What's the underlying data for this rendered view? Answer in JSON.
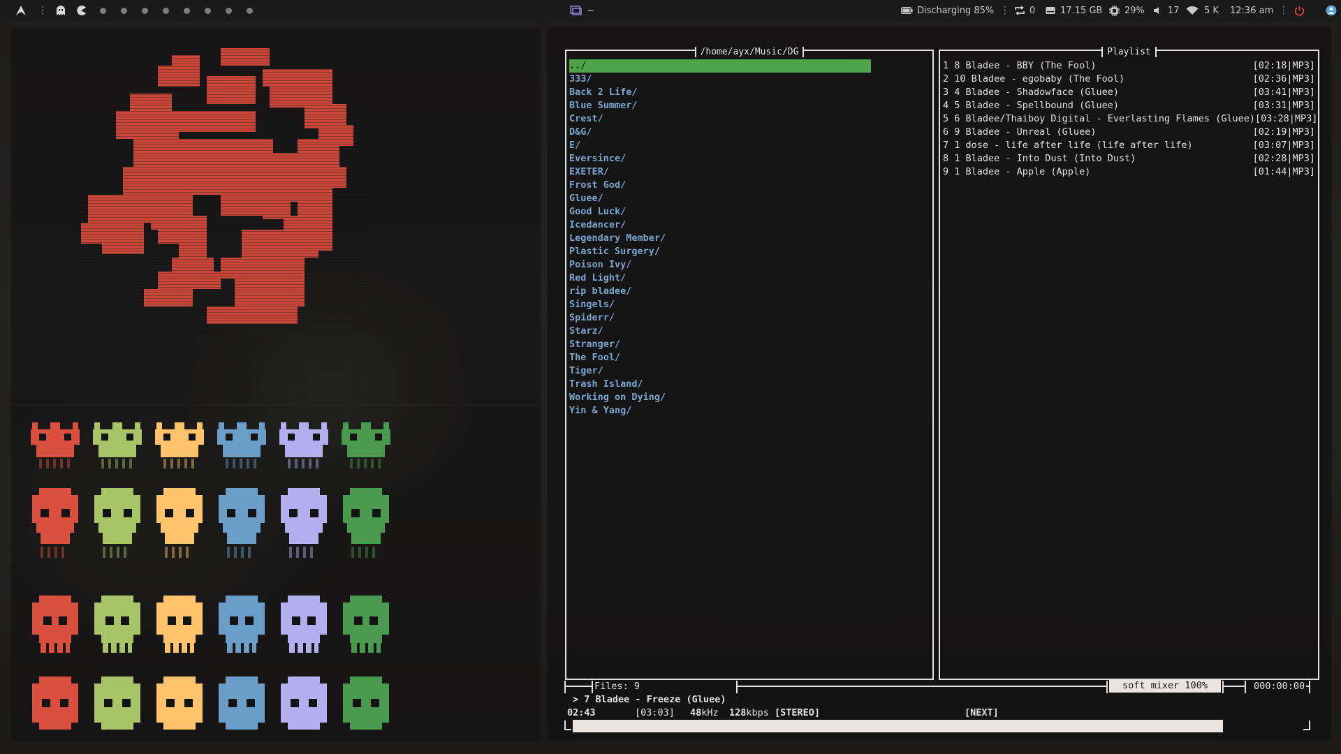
{
  "topbar": {
    "workspace_count": 8,
    "window_title": "~",
    "battery": "Discharging 85%",
    "updates": "0",
    "disk": "17.15 GB",
    "cpu": "29%",
    "volume": "17",
    "network": "5 K",
    "clock": "12:36 am",
    "icons": [
      "arch-logo-icon",
      "ghost-icon",
      "pacman-icon",
      "window-icon",
      "battery-icon",
      "sync-icon",
      "disk-icon",
      "cpu-icon",
      "speaker-icon",
      "wifi-icon",
      "power-icon",
      "user-avatar-icon"
    ]
  },
  "browser": {
    "title": "/home/ayx/Music/DG",
    "entries": [
      "../",
      "333/",
      "Back 2 Life/",
      "Blue Summer/",
      "Crest/",
      "D&G/",
      "E/",
      "Eversince/",
      "EXETER/",
      "Frost God/",
      "Gluee/",
      "Good Luck/",
      "Icedancer/",
      "Legendary Member/",
      "Plastic Surgery/",
      "Poison Ivy/",
      "Red Light/",
      "rip bladee/",
      "Singels/",
      "Spiderr/",
      "Starz/",
      "Stranger/",
      "The Fool/",
      "Tiger/",
      "Trash Island/",
      "Working on Dying/",
      "Yin & Yang/"
    ],
    "selected_index": 0
  },
  "playlist": {
    "title": "Playlist",
    "tracks": [
      {
        "text": "1 8 Bladee - BBY (The Fool)",
        "meta": "[02:18|MP3]"
      },
      {
        "text": "2 10 Bladee - egobaby (The Fool)",
        "meta": "[02:36|MP3]"
      },
      {
        "text": "3 4 Bladee - Shadowface (Gluee)",
        "meta": "[03:41|MP3]"
      },
      {
        "text": "4 5 Bladee - Spellbound (Gluee)",
        "meta": "[03:31|MP3]"
      },
      {
        "text": "5 6 Bladee/Thaiboy Digital - Everlasting Flames (Gluee)",
        "meta": "[03:28|MP3]"
      },
      {
        "text": "6 9 Bladee - Unreal (Gluee)",
        "meta": "[02:19|MP3]"
      },
      {
        "text": "7 1 dose - life after life (life after life)",
        "meta": "[03:07|MP3]"
      },
      {
        "text": "8 1 Bladee - Into Dust (Into Dust)",
        "meta": "[02:28|MP3]"
      },
      {
        "text": "9 1 Bladee - Apple (Apple)",
        "meta": "[01:44|MP3]"
      }
    ]
  },
  "status": {
    "files": "Files: 9",
    "mixer": "soft mixer 100%",
    "total_time": "000:00:00",
    "now_playing": "> 7 Bladee - Freeze (Gluee)",
    "elapsed": "02:43",
    "duration": "[03:03]",
    "samplerate": "48",
    "samplerate_unit": "kHz",
    "bitrate": "128",
    "bitrate_unit": "kbps",
    "channels": "[STEREO]",
    "next": "[NEXT]",
    "progress_fraction": 0.89
  },
  "colors": {
    "accent_green": "#4da44a",
    "dir_blue": "#7aa5cf",
    "dragon_red": "#c9483a",
    "skull_colors": [
      "#d9503f",
      "#a7c467",
      "#ffc46b",
      "#6b9dc9",
      "#b4b0f0",
      "#4a9a4e"
    ]
  }
}
